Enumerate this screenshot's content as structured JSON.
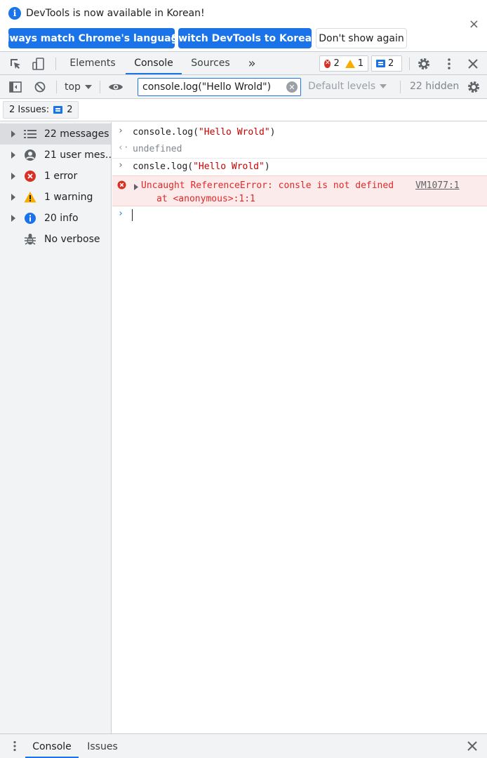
{
  "infobar": {
    "message": "DevTools is now available in Korean!",
    "info_icon": "i",
    "btn_match": "Always match Chrome's language",
    "btn_switch": "Switch DevTools to Korean",
    "btn_dont_show": "Don't show again",
    "close": "×"
  },
  "toolbar": {
    "tabs": [
      "Elements",
      "Console",
      "Sources"
    ],
    "active_tab": "Console",
    "more_tabs": "»",
    "error_count": "2",
    "warning_count": "1",
    "message_count": "2"
  },
  "console_toolbar": {
    "context": "top",
    "filter_value": "console.log(\"Hello Wrold\")",
    "levels": "Default levels",
    "hidden": "22 hidden"
  },
  "issues": {
    "label": "2 Issues:",
    "count": "2"
  },
  "sidebar": {
    "items": [
      {
        "label": "22 messages",
        "icon": "list-icon"
      },
      {
        "label": "21 user mes…",
        "icon": "user-icon"
      },
      {
        "label": "1 error",
        "icon": "error-icon"
      },
      {
        "label": "1 warning",
        "icon": "warning-icon"
      },
      {
        "label": "20 info",
        "icon": "info-icon"
      },
      {
        "label": "No verbose",
        "icon": "bug-icon"
      }
    ]
  },
  "console": {
    "input1_fn": "console.log(",
    "input1_str": "\"Hello Wrold\"",
    "input1_end": ")",
    "result1": "undefined",
    "input2_fn": "consle.log(",
    "input2_str": "\"Hello Wrold\"",
    "input2_end": ")",
    "error_message": "Uncaught ReferenceError: consle is not defined",
    "error_source": "VM1077:1",
    "error_stack": "at <anonymous>:1:1"
  },
  "drawer": {
    "tabs": [
      "Console",
      "Issues"
    ],
    "close": "×"
  },
  "colors": {
    "accent": "#1a73e8",
    "error": "#d93025",
    "warning": "#f9ab00"
  }
}
